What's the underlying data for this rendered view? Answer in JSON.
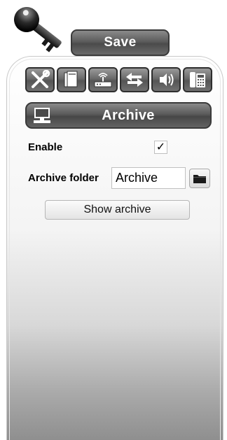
{
  "header": {
    "save_label": "Save",
    "key_icon": "key-icon"
  },
  "toolbar": {
    "tools": [
      {
        "icon": "tools-icon"
      },
      {
        "icon": "pages-icon"
      },
      {
        "icon": "network-icon"
      },
      {
        "icon": "transfer-arrows-icon"
      },
      {
        "icon": "audio-phone-icon"
      },
      {
        "icon": "desk-phone-icon"
      }
    ]
  },
  "section": {
    "title": "Archive",
    "icon": "computer-icon"
  },
  "form": {
    "enable_label": "Enable",
    "enable_checked": true,
    "enable_checkmark": "✓",
    "archive_folder_label": "Archive folder",
    "archive_folder_value": "Archive",
    "folder_icon": "folder-icon",
    "show_archive_label": "Show archive"
  },
  "colors": {
    "button_dark": "#4b4b4b",
    "button_text": "#ffffff",
    "panel_top": "#ffffff",
    "panel_bottom": "#8f8f8f"
  }
}
